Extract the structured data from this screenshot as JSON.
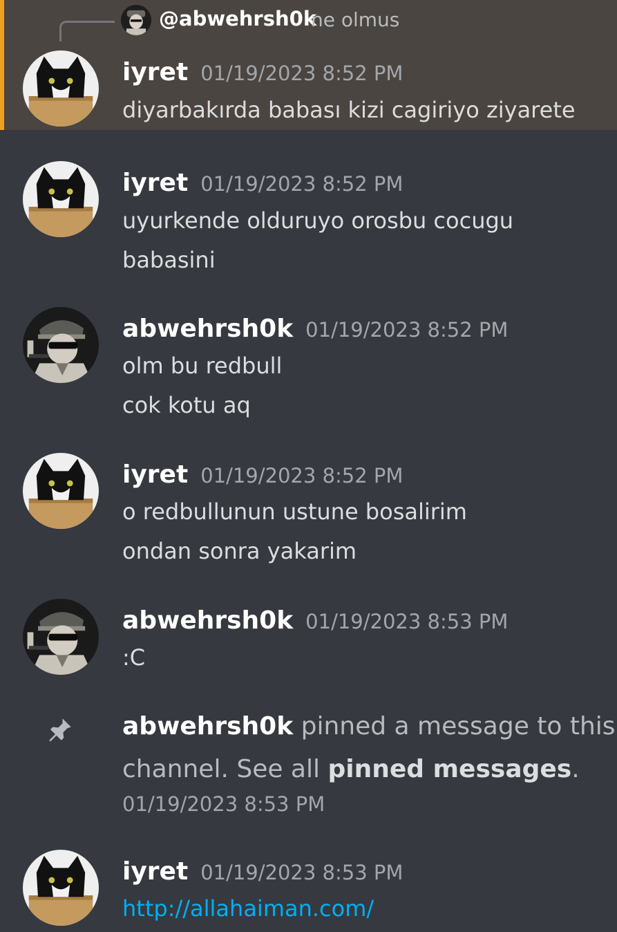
{
  "reply": {
    "author": "@abwehrsh0k",
    "text": "ne olmus"
  },
  "messages": [
    {
      "author": "iyret",
      "timestamp": "01/19/2023 8:52 PM",
      "lines": [
        "diyarbakırda babası kizi cagiriyo ziyarete"
      ],
      "avatar": "cat-avatar"
    },
    {
      "author": "iyret",
      "timestamp": "01/19/2023 8:52 PM",
      "lines": [
        "uyurkende olduruyo orosbu cocugu",
        "babasini"
      ],
      "avatar": "cat-avatar"
    },
    {
      "author": "abwehrsh0k",
      "timestamp": "01/19/2023 8:52 PM",
      "lines": [
        "olm bu redbull",
        "cok kotu aq"
      ],
      "avatar": "general-avatar"
    },
    {
      "author": "iyret",
      "timestamp": "01/19/2023 8:52 PM",
      "lines": [
        "o redbullunun ustune bosalirim",
        "ondan sonra yakarim"
      ],
      "avatar": "cat-avatar"
    },
    {
      "author": "abwehrsh0k",
      "timestamp": "01/19/2023 8:53 PM",
      "lines": [
        ":C"
      ],
      "avatar": "general-avatar"
    }
  ],
  "pinned": {
    "author": "abwehrsh0k",
    "text_1": " pinned a message to this",
    "text_2": "channel. See all ",
    "link": "pinned messages",
    "text_3": ".",
    "timestamp": "01/19/2023 8:53 PM",
    "icon": "pin-icon"
  },
  "last_message": {
    "author": "iyret",
    "timestamp": "01/19/2023 8:53 PM",
    "link": "http://allahaiman.com/",
    "avatar": "cat-avatar"
  },
  "colors": {
    "background": "#36393f",
    "highlight": "#4a4540",
    "highlight_accent": "#f0a020",
    "link": "#00aff4"
  }
}
